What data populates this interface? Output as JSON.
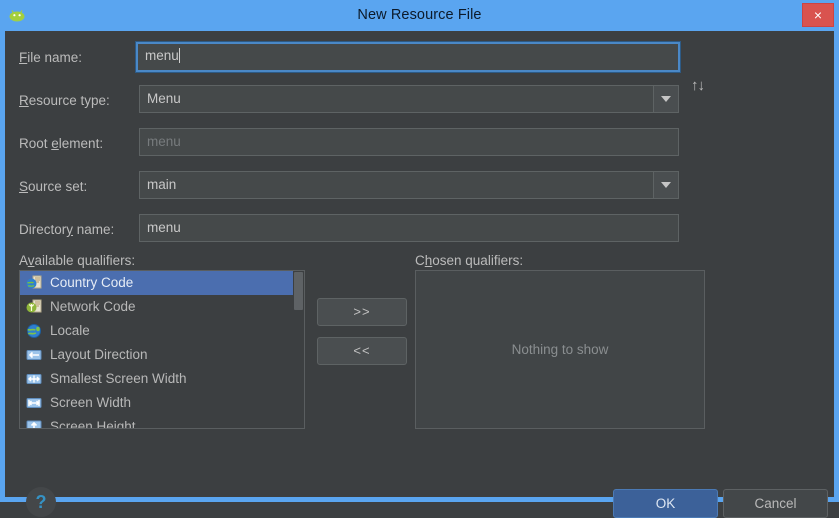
{
  "window": {
    "title": "New Resource File",
    "app_icon": "android-robot-icon",
    "close_label": "×",
    "frame_color": "#5aa5f0",
    "close_color": "#d9534f"
  },
  "form": {
    "file_name": {
      "label_pre": "F",
      "label_post": "ile name:",
      "value": "menu",
      "focused": true
    },
    "resource_type": {
      "label_pre": "R",
      "label_post": "esource type:",
      "value": "Menu",
      "options": [
        "Menu"
      ]
    },
    "root_element": {
      "label_pre_text": "Root ",
      "label_mn": "e",
      "label_post": "lement:",
      "placeholder": "menu",
      "value": ""
    },
    "source_set": {
      "label_pre": "S",
      "label_post": "ource set:",
      "value": "main",
      "options": [
        "main"
      ]
    },
    "directory_name": {
      "label_pre_text": "Director",
      "label_mn": "y",
      "label_post": " name:",
      "value": "menu"
    },
    "sort_icon": "↑↓"
  },
  "qualifiers": {
    "available_label_pre": "A",
    "available_label_mn": "v",
    "available_label_post": "ailable qualifiers:",
    "chosen_label_pre": "C",
    "chosen_label_mn": "h",
    "chosen_label_post": "osen qualifiers:",
    "available_items": [
      {
        "label": "Country Code",
        "icon": "globe-document-icon",
        "selected": true
      },
      {
        "label": "Network Code",
        "icon": "antenna-document-icon",
        "selected": false
      },
      {
        "label": "Locale",
        "icon": "globe-icon",
        "selected": false
      },
      {
        "label": "Layout Direction",
        "icon": "arrow-left-icon",
        "selected": false
      },
      {
        "label": "Smallest Screen Width",
        "icon": "arrows-horizontal-icon",
        "selected": false
      },
      {
        "label": "Screen Width",
        "icon": "arrow-width-icon",
        "selected": false
      },
      {
        "label": "Screen Height",
        "icon": "arrow-up-icon",
        "selected": false
      }
    ],
    "add_button": ">>",
    "remove_button": "<<",
    "chosen_empty_text": "Nothing to show",
    "selection_color": "#4b6eaf"
  },
  "footer": {
    "help_icon": "?",
    "ok_label": "OK",
    "cancel_label": "Cancel",
    "ok_color": "#3c6199"
  }
}
